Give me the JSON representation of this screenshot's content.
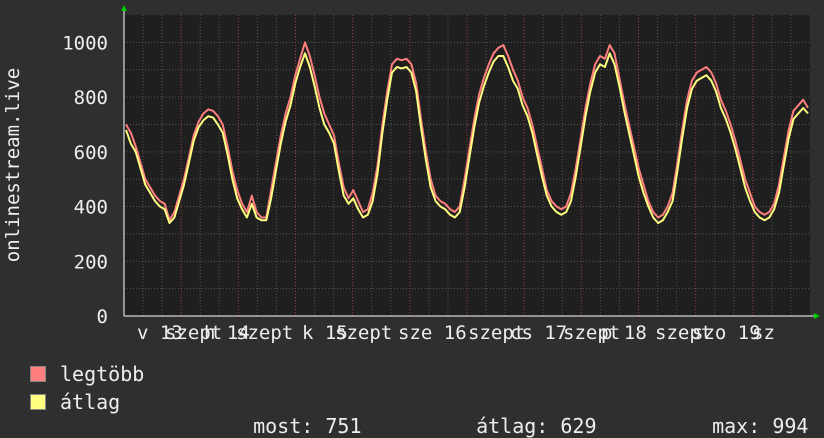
{
  "chart_data": {
    "type": "line",
    "ylabel": "onlinestream.live",
    "ylim": [
      0,
      1100
    ],
    "yticks": [
      0,
      200,
      400,
      600,
      800,
      1000
    ],
    "grid": true,
    "x_labels": [
      "v 13",
      "szept",
      "h 14",
      "szept",
      "k 15",
      "szept",
      "sze 16",
      "szept",
      "cs 17",
      "szept",
      "p 18",
      "szept",
      "szo 19",
      "sz"
    ],
    "series": [
      {
        "name": "legtöbb",
        "color": "#ff7f7f",
        "values": [
          700,
          670,
          620,
          560,
          500,
          470,
          440,
          420,
          410,
          350,
          380,
          440,
          500,
          580,
          660,
          710,
          740,
          755,
          750,
          730,
          700,
          620,
          530,
          460,
          410,
          380,
          440,
          380,
          360,
          360,
          460,
          560,
          660,
          740,
          800,
          880,
          940,
          1000,
          950,
          880,
          800,
          740,
          700,
          660,
          560,
          470,
          430,
          460,
          420,
          380,
          390,
          450,
          550,
          700,
          820,
          920,
          940,
          935,
          940,
          920,
          850,
          720,
          600,
          500,
          440,
          420,
          410,
          390,
          380,
          400,
          500,
          610,
          720,
          810,
          870,
          920,
          960,
          980,
          990,
          950,
          900,
          860,
          800,
          760,
          700,
          620,
          540,
          460,
          420,
          400,
          390,
          400,
          450,
          540,
          650,
          760,
          850,
          920,
          950,
          940,
          990,
          960,
          870,
          780,
          700,
          620,
          540,
          480,
          420,
          380,
          360,
          370,
          400,
          450,
          560,
          680,
          790,
          860,
          890,
          900,
          910,
          890,
          850,
          790,
          750,
          700,
          640,
          570,
          500,
          450,
          400,
          380,
          370,
          380,
          410,
          480,
          580,
          680,
          750,
          770,
          790,
          760
        ]
      },
      {
        "name": "átlag",
        "color": "#ffff80",
        "values": [
          680,
          630,
          600,
          540,
          480,
          450,
          420,
          400,
          390,
          340,
          360,
          420,
          480,
          560,
          640,
          690,
          715,
          730,
          725,
          700,
          670,
          590,
          500,
          430,
          390,
          360,
          410,
          360,
          350,
          350,
          430,
          530,
          630,
          710,
          770,
          850,
          910,
          960,
          910,
          840,
          760,
          700,
          670,
          630,
          530,
          440,
          410,
          430,
          390,
          360,
          370,
          420,
          520,
          670,
          790,
          890,
          910,
          905,
          910,
          890,
          820,
          690,
          570,
          470,
          420,
          400,
          390,
          370,
          360,
          380,
          470,
          580,
          690,
          780,
          840,
          890,
          930,
          950,
          950,
          910,
          860,
          830,
          770,
          730,
          670,
          590,
          510,
          440,
          400,
          380,
          370,
          380,
          420,
          510,
          620,
          730,
          820,
          890,
          920,
          910,
          960,
          920,
          840,
          750,
          670,
          590,
          510,
          450,
          400,
          360,
          340,
          350,
          380,
          420,
          530,
          650,
          760,
          830,
          860,
          870,
          880,
          860,
          820,
          760,
          720,
          670,
          610,
          540,
          470,
          420,
          380,
          360,
          350,
          360,
          390,
          450,
          550,
          650,
          720,
          740,
          760,
          740
        ]
      }
    ],
    "legend": [
      {
        "label": "legtöbb",
        "color": "#ff7f7f"
      },
      {
        "label": "átlag",
        "color": "#ffff80"
      }
    ],
    "stats": {
      "most_label": "most:",
      "most_value": "751",
      "atlag_label": "átlag:",
      "atlag_value": "629",
      "max_label": "max:",
      "max_value": "994"
    }
  },
  "colors": {
    "background": "#2f2f2f",
    "plot_background": "#1f1f1f",
    "grid_major": "#555555",
    "grid_minor_vertical": "#a04040",
    "axis_arrow": "#00cc00"
  }
}
